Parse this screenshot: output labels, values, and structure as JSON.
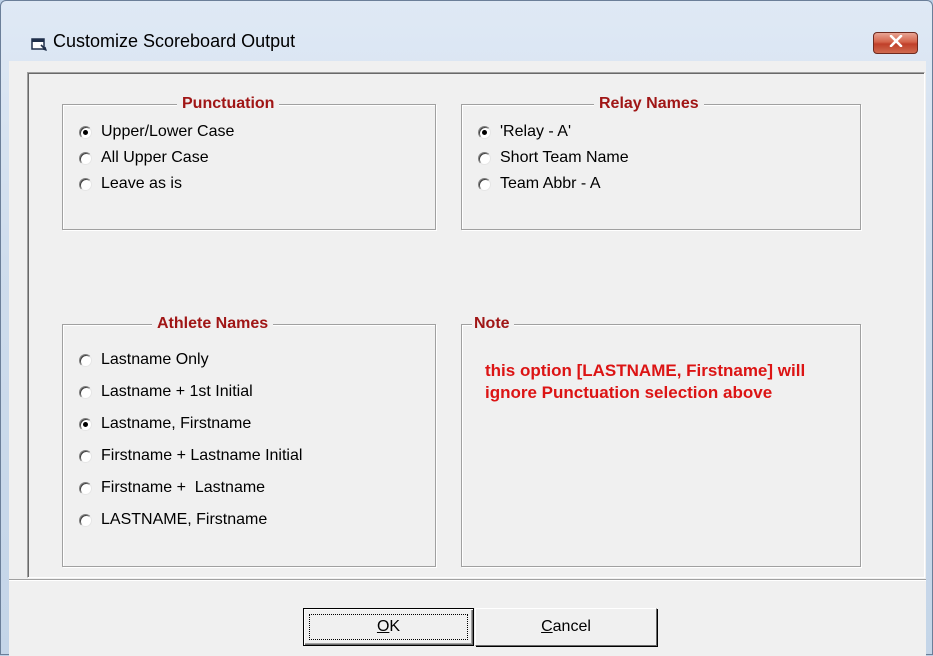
{
  "window": {
    "title": "Customize Scoreboard Output",
    "icon": "form-window-icon",
    "close_icon": "close-x-icon",
    "accent_colors": {
      "group_title": "#a01616",
      "note_text": "#dc1414",
      "close_button": "#c0402a"
    }
  },
  "punctuation": {
    "title": "Punctuation",
    "options": [
      {
        "label": "Upper/Lower Case",
        "checked": true
      },
      {
        "label": "All Upper Case",
        "checked": false
      },
      {
        "label": "Leave as is",
        "checked": false
      }
    ]
  },
  "relay_names": {
    "title": "Relay Names",
    "options": [
      {
        "label": "'Relay - A'",
        "checked": true
      },
      {
        "label": "Short Team Name",
        "checked": false
      },
      {
        "label": "Team Abbr - A",
        "checked": false
      }
    ]
  },
  "athlete_names": {
    "title": "Athlete Names",
    "options": [
      {
        "label": "Lastname Only",
        "checked": false
      },
      {
        "label": "Lastname + 1st Initial",
        "checked": false
      },
      {
        "label": "Lastname, Firstname",
        "checked": true
      },
      {
        "label": "Firstname + Lastname Initial",
        "checked": false
      },
      {
        "label": "Firstname +  Lastname",
        "checked": false
      },
      {
        "label": "LASTNAME, Firstname",
        "checked": false
      }
    ]
  },
  "note": {
    "title": "Note",
    "text": "this option [LASTNAME, Firstname] will ignore Punctuation selection above"
  },
  "buttons": {
    "ok": {
      "accel": "O",
      "rest": "K"
    },
    "cancel": {
      "accel": "C",
      "rest": "ancel"
    }
  }
}
